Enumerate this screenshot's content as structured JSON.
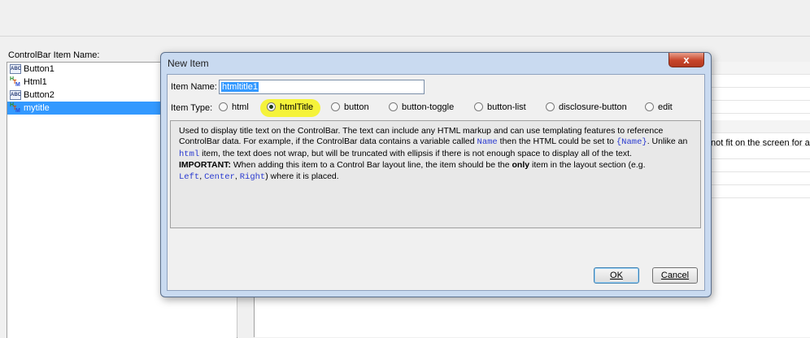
{
  "left_panel": {
    "label": "ControlBar Item Name:",
    "items": [
      {
        "label": "Button1",
        "icon": "abc-icon"
      },
      {
        "label": "Html1",
        "icon": "htm-icon"
      },
      {
        "label": "Button2",
        "icon": "abc-icon"
      },
      {
        "label": "mytitle",
        "icon": "htm-icon",
        "selected": true
      }
    ]
  },
  "right_panel": {
    "partial_text": "not fit on the screen for a"
  },
  "dialog": {
    "title": "New Item",
    "close_label": "x",
    "item_name_label": "Item Name:",
    "item_name_value": "htmltitle1",
    "item_type_label": "Item Type:",
    "types": [
      "html",
      "htmlTitle",
      "button",
      "button-toggle",
      "button-list",
      "disclosure-button",
      "edit"
    ],
    "selected_type": "htmlTitle",
    "description": {
      "p1": "Used to display title text on the ControlBar. The text can include any HTML markup and can use templating features to reference ControlBar data. For example, if the ControlBar data contains a variable called",
      "code_name": "Name",
      "p2": "then the HTML could be set to",
      "code_template": "{Name}",
      "p3": "Unlike an",
      "code_html": "html",
      "p4": "item, the text does not wrap, but will be truncated with ellipsis if there is not enough space to display all of the text.",
      "important_label": "IMPORTANT:",
      "p5": "When adding this item to a Control Bar layout line, the item should be the",
      "only": "only",
      "p6": "item in the layout section (e.g.",
      "code_left": "Left",
      "code_center": "Center",
      "code_right": "Right",
      "p7": ") where it is placed."
    },
    "ok_label": "OK",
    "cancel_label": "Cancel"
  },
  "colors": {
    "selection": "#3399ff",
    "highlight": "#f6f31a",
    "code": "#2a3ad0"
  }
}
